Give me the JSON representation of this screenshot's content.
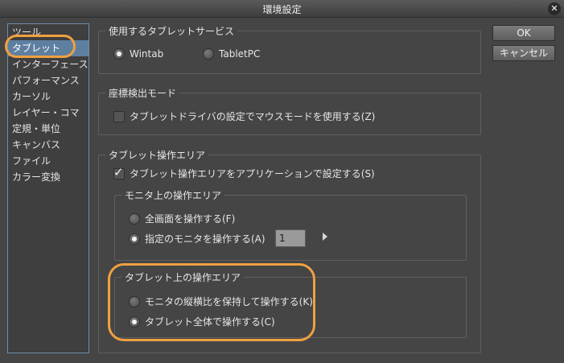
{
  "window": {
    "title": "環境設定",
    "close_glyph": "✕"
  },
  "sidebar": {
    "items": [
      {
        "label": "ツール"
      },
      {
        "label": "タブレット"
      },
      {
        "label": "インターフェース"
      },
      {
        "label": "パフォーマンス"
      },
      {
        "label": "カーソル"
      },
      {
        "label": "レイヤー・コマ"
      },
      {
        "label": "定規・単位"
      },
      {
        "label": "キャンバス"
      },
      {
        "label": "ファイル"
      },
      {
        "label": "カラー変換"
      }
    ],
    "selected_index": 1
  },
  "tablet_service": {
    "legend": "使用するタブレットサービス",
    "options": [
      {
        "label": "Wintab",
        "selected": true
      },
      {
        "label": "TabletPC",
        "selected": false
      }
    ]
  },
  "coord_mode": {
    "legend": "座標検出モード",
    "checkbox_label": "タブレットドライバの設定でマウスモードを使用する(Z)",
    "checked": false
  },
  "operation_area": {
    "legend": "タブレット操作エリア",
    "checkbox_label": "タブレット操作エリアをアプリケーションで設定する(S)",
    "checked": true,
    "monitor_area": {
      "legend": "モニタ上の操作エリア",
      "options": [
        {
          "label": "全画面を操作する(F)",
          "selected": false
        },
        {
          "label": "指定のモニタを操作する(A)",
          "selected": true
        }
      ],
      "monitor_number": "1"
    },
    "tablet_area": {
      "legend": "タブレット上の操作エリア",
      "options": [
        {
          "label": "モニタの縦横比を保持して操作する(K)",
          "selected": false
        },
        {
          "label": "タブレット全体で操作する(C)",
          "selected": true
        }
      ]
    }
  },
  "buttons": {
    "ok": "OK",
    "cancel": "キャンセル"
  },
  "colors": {
    "highlight": "#f0a040",
    "selected_bg": "#5e7fa0",
    "background": "#454545"
  }
}
